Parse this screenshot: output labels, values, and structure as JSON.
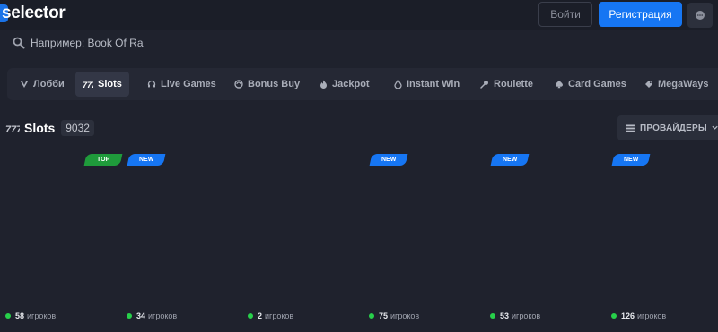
{
  "header": {
    "logo": "selector",
    "login_label": "Войти",
    "register_label": "Регистрация",
    "brand_color": "#1676f3"
  },
  "search": {
    "placeholder": "Например: Book Of Ra"
  },
  "nav": {
    "items": [
      {
        "label": "Лобби",
        "icon": "lobby-icon"
      },
      {
        "label": "Slots",
        "icon": "slots-icon",
        "active": true
      },
      {
        "label": "Live Games",
        "icon": "headset-icon"
      },
      {
        "label": "Bonus Buy",
        "icon": "bonus-buy-icon"
      },
      {
        "label": "Jackpot",
        "icon": "flame-icon"
      },
      {
        "label": "Instant Win",
        "icon": "drop-icon"
      },
      {
        "label": "Roulette",
        "icon": "roulette-icon"
      },
      {
        "label": "Card Games",
        "icon": "spade-icon"
      },
      {
        "label": "MegaWays",
        "icon": "megaways-icon"
      }
    ]
  },
  "slots": {
    "title": "Slots",
    "count": "9032",
    "providers_label": "ПРОВАЙДЕРЫ"
  },
  "games": [
    {
      "badges": [],
      "players": "58",
      "players_suffix": "игроков"
    },
    {
      "badges": [
        "TOP",
        "NEW"
      ],
      "players": "34",
      "players_suffix": "игроков"
    },
    {
      "badges": [],
      "players": "2",
      "players_suffix": "игроков"
    },
    {
      "badges": [
        "NEW"
      ],
      "players": "75",
      "players_suffix": "игроков"
    },
    {
      "badges": [
        "NEW"
      ],
      "players": "53",
      "players_suffix": "игроков"
    },
    {
      "badges": [
        "NEW"
      ],
      "players": "126",
      "players_suffix": "игроков"
    }
  ],
  "colors": {
    "badge_top": "#1f9b3b",
    "badge_new": "#1676f3",
    "online_dot": "#27d04a"
  }
}
